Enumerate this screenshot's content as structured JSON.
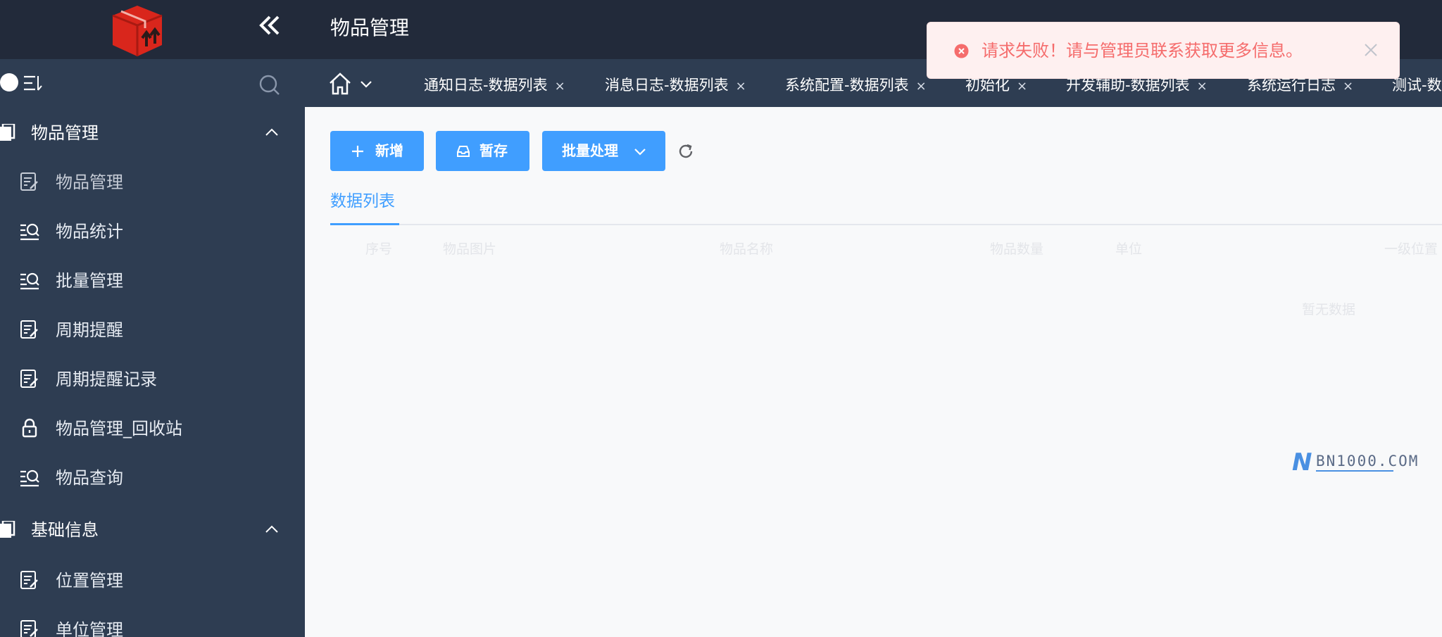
{
  "colors": {
    "sidebar_bg": "#2e3d52",
    "header_bg": "#222a3a",
    "primary": "#409eff",
    "error": "#f56c6c",
    "error_bg": "#fef0f0",
    "logo_red": "#d9261c"
  },
  "header": {
    "title": "物品管理",
    "collapse_icon": "double-chevron-left-icon"
  },
  "sidebar": {
    "search_icon": "search-icon",
    "groups": [
      {
        "label": "物品管理",
        "icon": "folder-icon",
        "expanded": true,
        "items": [
          {
            "label": "物品管理",
            "icon": "edit-doc-icon"
          },
          {
            "label": "物品统计",
            "icon": "list-search-icon"
          },
          {
            "label": "批量管理",
            "icon": "list-search-icon"
          },
          {
            "label": "周期提醒",
            "icon": "edit-doc-icon"
          },
          {
            "label": "周期提醒记录",
            "icon": "edit-doc-icon"
          },
          {
            "label": "物品管理_回收站",
            "icon": "lock-icon"
          },
          {
            "label": "物品查询",
            "icon": "list-search-icon"
          }
        ]
      },
      {
        "label": "基础信息",
        "icon": "folder-icon",
        "expanded": true,
        "items": [
          {
            "label": "位置管理",
            "icon": "edit-doc-icon"
          },
          {
            "label": "单位管理",
            "icon": "edit-doc-icon"
          }
        ]
      }
    ]
  },
  "tabs": [
    {
      "label": "通知日志-数据列表",
      "close": "×"
    },
    {
      "label": "消息日志-数据列表",
      "close": "×"
    },
    {
      "label": "系统配置-数据列表",
      "close": "×"
    },
    {
      "label": "初始化",
      "close": "×"
    },
    {
      "label": "开发辅助-数据列表",
      "close": "×"
    },
    {
      "label": "系统运行日志",
      "close": "×"
    },
    {
      "label": "测试-数",
      "close": ""
    }
  ],
  "toolbar": {
    "add_label": "新增",
    "draft_label": "暂存",
    "batch_label": "批量处理"
  },
  "content": {
    "sub_tab": "数据列表",
    "columns": [
      "序号",
      "物品图片",
      "物品名称",
      "物品数量",
      "单位",
      "一级位置"
    ],
    "empty_text": "暂无数据"
  },
  "toast": {
    "message": "请求失败！请与管理员联系获取更多信息。",
    "type": "error"
  },
  "watermark": {
    "letter": "N",
    "text": "BN1000.COM"
  }
}
